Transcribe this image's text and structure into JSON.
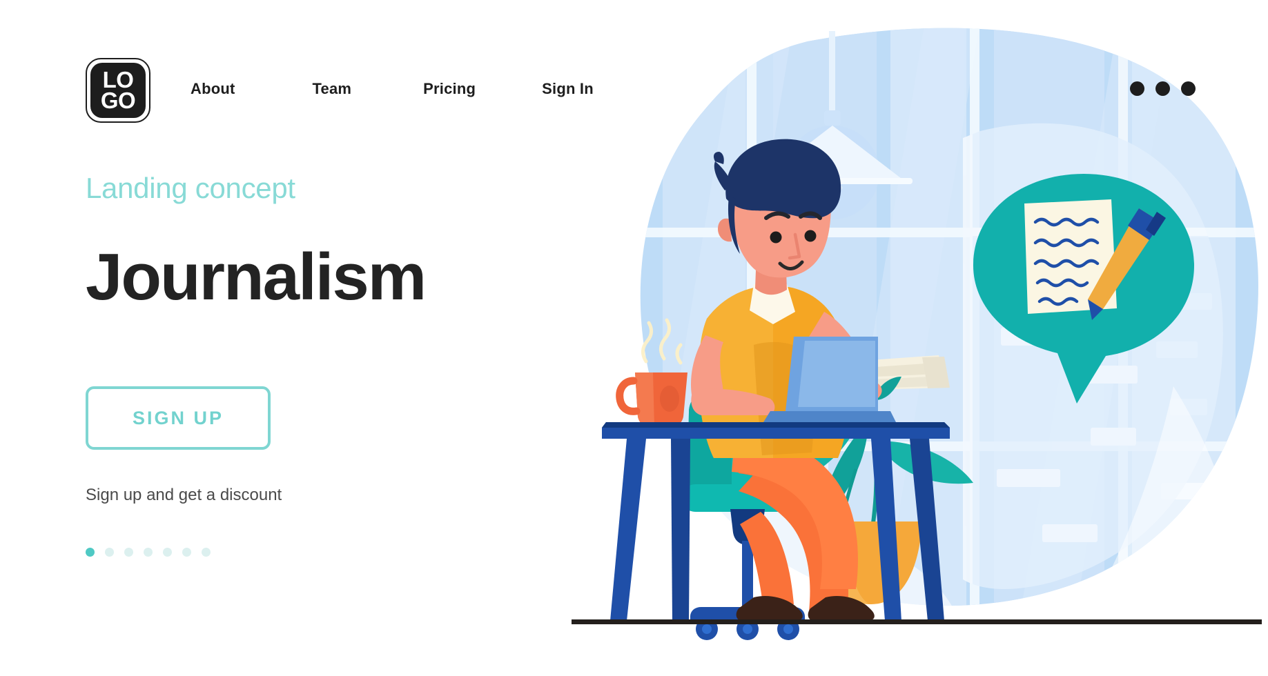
{
  "header": {
    "logo": {
      "name": "logo",
      "line1": "LO",
      "line2": "GO"
    },
    "nav": [
      {
        "label": "About",
        "name": "nav-about"
      },
      {
        "label": "Team",
        "name": "nav-team"
      },
      {
        "label": "Pricing",
        "name": "nav-pricing"
      },
      {
        "label": "Sign In",
        "name": "nav-sign-in"
      }
    ],
    "menu": {
      "name": "overflow-menu",
      "dots": 3
    }
  },
  "hero": {
    "eyebrow": "Landing concept",
    "headline": "Journalism",
    "cta_label": "SIGN UP",
    "subtext": "Sign up and get a discount",
    "carousel": {
      "count": 7,
      "active_index": 0
    }
  },
  "colors": {
    "accent_teal": "#88dad6",
    "cta_border": "#7fd6d2",
    "cta_text": "#72d2ce",
    "dot_active": "#4fc9c4",
    "dot_inactive": "#dcf0ef",
    "headline": "#232323",
    "nav_text": "#1d1d1d",
    "subtext": "#4a4a4a",
    "blob_blue": "#bedcf7",
    "blob_pale": "#e3effc",
    "bubble_teal": "#12b0ac",
    "desk_blue": "#1f4fa8",
    "desk_dark": "#123a80",
    "shirt_yellow": "#f5a623",
    "pants_orange": "#fa7239",
    "chair_teal": "#0fb9b0",
    "skin": "#f79c87",
    "hair_navy": "#1d3468",
    "paper_cream": "#fbf6e3",
    "pen_gold": "#f0ab3f",
    "plant_teal": "#17b3a8",
    "pot_orange": "#f5a83a",
    "mug_orange": "#f0653a",
    "laptop_blue": "#6fa3e0",
    "floor_line": "#241f1c"
  },
  "illustration": {
    "name": "journalism-scene",
    "elements": [
      "background-blob",
      "window-frame",
      "pendant-lamp",
      "speech-bubble",
      "notepad-paper",
      "pen",
      "person",
      "laptop",
      "coffee-mug",
      "desk",
      "office-chair",
      "paper-stack",
      "potted-plant",
      "floor-line"
    ]
  }
}
